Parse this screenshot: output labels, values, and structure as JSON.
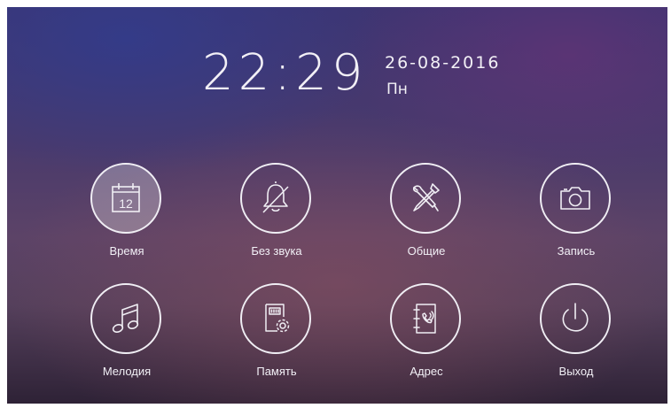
{
  "clock": {
    "time": "22:29",
    "date": "26-08-2016",
    "weekday": "Пн"
  },
  "menu": [
    {
      "label": "Время",
      "icon": "calendar-icon",
      "day": "12",
      "active": true
    },
    {
      "label": "Без звука",
      "icon": "bell-muted-icon"
    },
    {
      "label": "Общие",
      "icon": "tools-icon"
    },
    {
      "label": "Запись",
      "icon": "camera-icon"
    },
    {
      "label": "Мелодия",
      "icon": "music-note-icon"
    },
    {
      "label": "Память",
      "icon": "sd-card-settings-icon",
      "chip": "IIIII"
    },
    {
      "label": "Адрес",
      "icon": "address-book-icon"
    },
    {
      "label": "Выход",
      "icon": "power-icon"
    }
  ],
  "colors": {
    "icon_stroke": "#f0eef4",
    "active_fill": "rgba(255,255,255,0.28)"
  }
}
